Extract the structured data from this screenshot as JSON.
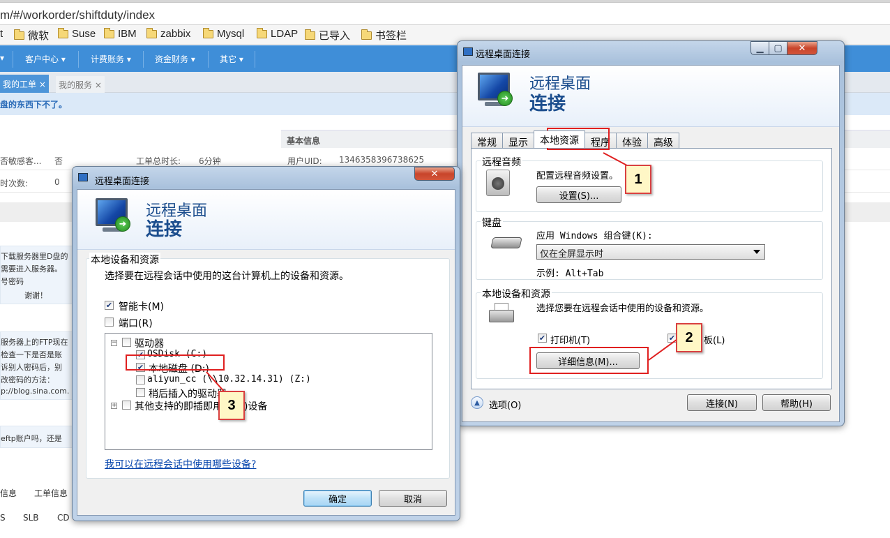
{
  "browser": {
    "url": "m/#/workorder/shiftduty/index",
    "bookmarks": [
      "t",
      "微软",
      "Suse",
      "IBM",
      "zabbix",
      "Mysql",
      "LDAP",
      "已导入",
      "书签栏"
    ]
  },
  "app": {
    "nav": [
      "客户中心",
      "计费账务",
      "资金财务",
      "其它"
    ],
    "tabs": [
      "我的工单",
      "我的服务"
    ],
    "notice": "盘的东西下不了。",
    "info_header": "基本信息",
    "row1": {
      "c1": "否敏感客...",
      "c2": "否",
      "c3": "工单总时长:",
      "c4": "6分钟",
      "c5": "用户UID:",
      "c6": "1346358396738625"
    },
    "row2": {
      "c1": "时次数:",
      "c2": "0"
    },
    "msg1": [
      "下载服务器里D盘的",
      "需要进入服务器。",
      "号密码",
      "谢谢！"
    ],
    "msg2": [
      "服务器上的FTP现在",
      "检查一下是否是账",
      "诉别人密码后，别",
      "改密码的方法：",
      "p://blog.sina.com."
    ],
    "msg3": "eftp账户吗，还是",
    "footer": [
      "信息",
      "工单信息",
      "S",
      "SLB",
      "CD"
    ]
  },
  "dialog_main": {
    "title": "远程桌面连接",
    "banner_line1": "远程桌面",
    "banner_line2": "连接",
    "tabs": [
      "常规",
      "显示",
      "本地资源",
      "程序",
      "体验",
      "高级"
    ],
    "audio": {
      "group": "远程音频",
      "text": "配置远程音频设置。",
      "button": "设置(S)..."
    },
    "keyboard": {
      "group": "键盘",
      "text": "应用 Windows 组合键(K):",
      "selected": "仅在全屏显示时",
      "example": "示例: Alt+Tab"
    },
    "local": {
      "group": "本地设备和资源",
      "text": "选择您要在远程会话中使用的设备和资源。",
      "printer": "打印机(T)",
      "clipboard": "板(L)",
      "details_button": "详细信息(M)..."
    },
    "options": "选项(O)",
    "connect": "连接(N)",
    "help": "帮助(H)"
  },
  "dialog_local": {
    "title": "远程桌面连接",
    "banner_line1": "远程桌面",
    "banner_line2": "连接",
    "group": "本地设备和资源",
    "instruction": "选择要在远程会话中使用的这台计算机上的设备和资源。",
    "smartcard": "智能卡(M)",
    "ports": "端口(R)",
    "drives": "驱动器",
    "drive_c": "OSDisk (C:)",
    "drive_d": "本地磁盘 (D:)",
    "drive_z": "aliyun_cc (\\\\10.32.14.31) (Z:)",
    "later_drives": "稍后插入的驱动器",
    "pnp": "其他支持的即插即用(PnP)设备",
    "link": "我可以在远程会话中使用哪些设备?",
    "ok": "确定",
    "cancel": "取消"
  },
  "callouts": [
    "1",
    "2",
    "3"
  ],
  "colors": {
    "accent_red": "#e02020",
    "callout_bg": "#fff7c6",
    "nav_blue": "#3f8ed8",
    "banner_text": "#1b4d8d"
  }
}
